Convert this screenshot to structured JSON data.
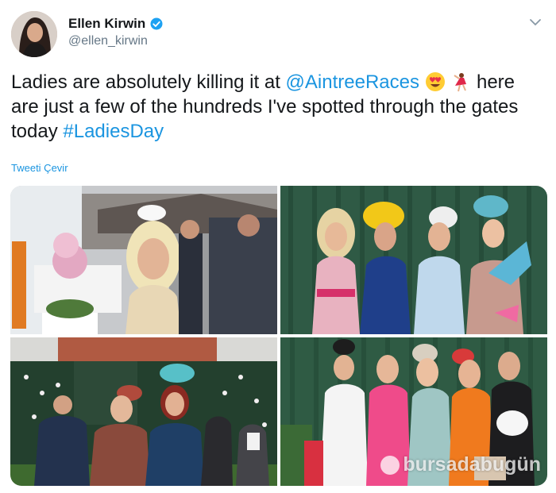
{
  "author": {
    "display_name": "Ellen Kirwin",
    "handle": "@ellen_kirwin",
    "verified": true
  },
  "tweet": {
    "text_part1": "Ladies are absolutely killing it at ",
    "mention": "@AintreeRaces",
    "text_part2": " here are just a few of the hundreds I've spotted through the gates today ",
    "hashtag": "#LadiesDay",
    "emojis": [
      "heart-eyes-emoji",
      "dancer-emoji"
    ]
  },
  "translate_label": "Tweeti Çevir",
  "media": {
    "photos": [
      {
        "name": "photo-racegoer-white-fascinator"
      },
      {
        "name": "photo-five-ladies-green-wall"
      },
      {
        "name": "photo-two-ladies-floral-wall"
      },
      {
        "name": "photo-five-ladies-colorful-dresses"
      }
    ],
    "watermark": "bursadabugün"
  },
  "icons": {
    "verified": "verified-badge-icon",
    "caret": "chevron-down-icon"
  },
  "colors": {
    "link": "#1b95e0",
    "text": "#14171a",
    "secondary": "#657786",
    "verified": "#1da1f2"
  }
}
